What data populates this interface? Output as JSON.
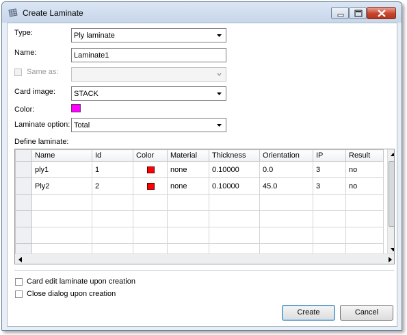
{
  "window": {
    "title": "Create Laminate",
    "icon": "grid-icon"
  },
  "form": {
    "type_label": "Type:",
    "type_value": "Ply laminate",
    "name_label": "Name:",
    "name_value": "Laminate1",
    "same_as_label": "Same as:",
    "same_as_value": "",
    "card_image_label": "Card image:",
    "card_image_value": "STACK",
    "color_label": "Color:",
    "color_value": "#ff00ff",
    "laminate_option_label": "Laminate option:",
    "laminate_option_value": "Total",
    "define_laminate_label": "Define laminate:"
  },
  "grid": {
    "columns": [
      "Name",
      "Id",
      "Color",
      "Material",
      "Thickness",
      "Orientation",
      "IP",
      "Result"
    ],
    "rows": [
      {
        "name": "ply1",
        "id": "1",
        "color": "#ff0000",
        "material": "none",
        "thickness": "0.10000",
        "orientation": "0.0",
        "ip": "3",
        "result": "no"
      },
      {
        "name": "Ply2",
        "id": "2",
        "color": "#ff0000",
        "material": "none",
        "thickness": "0.10000",
        "orientation": "45.0",
        "ip": "3",
        "result": "no"
      }
    ]
  },
  "options": {
    "card_edit_label": "Card edit laminate upon creation",
    "close_dialog_label": "Close dialog upon creation"
  },
  "buttons": {
    "create": "Create",
    "cancel": "Cancel"
  }
}
